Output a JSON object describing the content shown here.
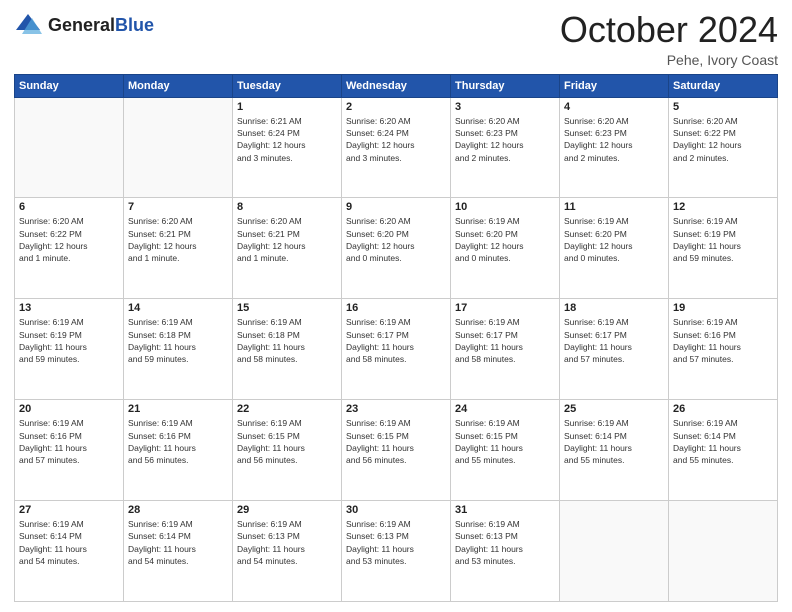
{
  "header": {
    "logo_general": "General",
    "logo_blue": "Blue",
    "month_title": "October 2024",
    "subtitle": "Pehe, Ivory Coast"
  },
  "weekdays": [
    "Sunday",
    "Monday",
    "Tuesday",
    "Wednesday",
    "Thursday",
    "Friday",
    "Saturday"
  ],
  "weeks": [
    [
      {
        "day": "",
        "info": ""
      },
      {
        "day": "",
        "info": ""
      },
      {
        "day": "1",
        "info": "Sunrise: 6:21 AM\nSunset: 6:24 PM\nDaylight: 12 hours\nand 3 minutes."
      },
      {
        "day": "2",
        "info": "Sunrise: 6:20 AM\nSunset: 6:24 PM\nDaylight: 12 hours\nand 3 minutes."
      },
      {
        "day": "3",
        "info": "Sunrise: 6:20 AM\nSunset: 6:23 PM\nDaylight: 12 hours\nand 2 minutes."
      },
      {
        "day": "4",
        "info": "Sunrise: 6:20 AM\nSunset: 6:23 PM\nDaylight: 12 hours\nand 2 minutes."
      },
      {
        "day": "5",
        "info": "Sunrise: 6:20 AM\nSunset: 6:22 PM\nDaylight: 12 hours\nand 2 minutes."
      }
    ],
    [
      {
        "day": "6",
        "info": "Sunrise: 6:20 AM\nSunset: 6:22 PM\nDaylight: 12 hours\nand 1 minute."
      },
      {
        "day": "7",
        "info": "Sunrise: 6:20 AM\nSunset: 6:21 PM\nDaylight: 12 hours\nand 1 minute."
      },
      {
        "day": "8",
        "info": "Sunrise: 6:20 AM\nSunset: 6:21 PM\nDaylight: 12 hours\nand 1 minute."
      },
      {
        "day": "9",
        "info": "Sunrise: 6:20 AM\nSunset: 6:20 PM\nDaylight: 12 hours\nand 0 minutes."
      },
      {
        "day": "10",
        "info": "Sunrise: 6:19 AM\nSunset: 6:20 PM\nDaylight: 12 hours\nand 0 minutes."
      },
      {
        "day": "11",
        "info": "Sunrise: 6:19 AM\nSunset: 6:20 PM\nDaylight: 12 hours\nand 0 minutes."
      },
      {
        "day": "12",
        "info": "Sunrise: 6:19 AM\nSunset: 6:19 PM\nDaylight: 11 hours\nand 59 minutes."
      }
    ],
    [
      {
        "day": "13",
        "info": "Sunrise: 6:19 AM\nSunset: 6:19 PM\nDaylight: 11 hours\nand 59 minutes."
      },
      {
        "day": "14",
        "info": "Sunrise: 6:19 AM\nSunset: 6:18 PM\nDaylight: 11 hours\nand 59 minutes."
      },
      {
        "day": "15",
        "info": "Sunrise: 6:19 AM\nSunset: 6:18 PM\nDaylight: 11 hours\nand 58 minutes."
      },
      {
        "day": "16",
        "info": "Sunrise: 6:19 AM\nSunset: 6:17 PM\nDaylight: 11 hours\nand 58 minutes."
      },
      {
        "day": "17",
        "info": "Sunrise: 6:19 AM\nSunset: 6:17 PM\nDaylight: 11 hours\nand 58 minutes."
      },
      {
        "day": "18",
        "info": "Sunrise: 6:19 AM\nSunset: 6:17 PM\nDaylight: 11 hours\nand 57 minutes."
      },
      {
        "day": "19",
        "info": "Sunrise: 6:19 AM\nSunset: 6:16 PM\nDaylight: 11 hours\nand 57 minutes."
      }
    ],
    [
      {
        "day": "20",
        "info": "Sunrise: 6:19 AM\nSunset: 6:16 PM\nDaylight: 11 hours\nand 57 minutes."
      },
      {
        "day": "21",
        "info": "Sunrise: 6:19 AM\nSunset: 6:16 PM\nDaylight: 11 hours\nand 56 minutes."
      },
      {
        "day": "22",
        "info": "Sunrise: 6:19 AM\nSunset: 6:15 PM\nDaylight: 11 hours\nand 56 minutes."
      },
      {
        "day": "23",
        "info": "Sunrise: 6:19 AM\nSunset: 6:15 PM\nDaylight: 11 hours\nand 56 minutes."
      },
      {
        "day": "24",
        "info": "Sunrise: 6:19 AM\nSunset: 6:15 PM\nDaylight: 11 hours\nand 55 minutes."
      },
      {
        "day": "25",
        "info": "Sunrise: 6:19 AM\nSunset: 6:14 PM\nDaylight: 11 hours\nand 55 minutes."
      },
      {
        "day": "26",
        "info": "Sunrise: 6:19 AM\nSunset: 6:14 PM\nDaylight: 11 hours\nand 55 minutes."
      }
    ],
    [
      {
        "day": "27",
        "info": "Sunrise: 6:19 AM\nSunset: 6:14 PM\nDaylight: 11 hours\nand 54 minutes."
      },
      {
        "day": "28",
        "info": "Sunrise: 6:19 AM\nSunset: 6:14 PM\nDaylight: 11 hours\nand 54 minutes."
      },
      {
        "day": "29",
        "info": "Sunrise: 6:19 AM\nSunset: 6:13 PM\nDaylight: 11 hours\nand 54 minutes."
      },
      {
        "day": "30",
        "info": "Sunrise: 6:19 AM\nSunset: 6:13 PM\nDaylight: 11 hours\nand 53 minutes."
      },
      {
        "day": "31",
        "info": "Sunrise: 6:19 AM\nSunset: 6:13 PM\nDaylight: 11 hours\nand 53 minutes."
      },
      {
        "day": "",
        "info": ""
      },
      {
        "day": "",
        "info": ""
      }
    ]
  ]
}
